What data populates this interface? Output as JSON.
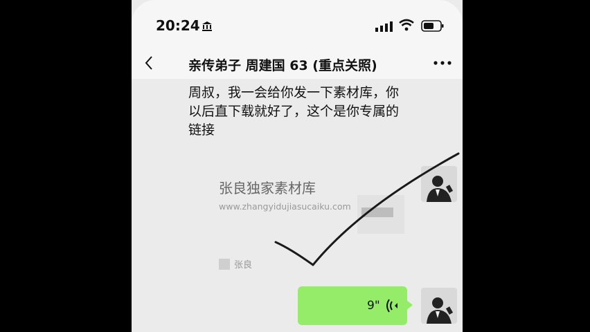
{
  "status_bar": {
    "time": "20:24",
    "icons": [
      "bank-icon",
      "signal-icon",
      "wifi-icon",
      "battery-icon"
    ]
  },
  "chat_header": {
    "back_icon": "chevron-left-icon",
    "title": "亲传弟子 周建国 63 (重点关照)",
    "more_icon": "more-dots-icon"
  },
  "messages": {
    "text_message": "周叔，我一会给你发一下素材库，你以后直下载就好了，这个是你专属的链接",
    "link_card": {
      "title": "张良独家素材库",
      "url": "www.zhangyidujiasucaiku.com",
      "author": "张良"
    },
    "voice_message": {
      "duration": "9\"",
      "icon": "voice-wave-icon"
    }
  },
  "colors": {
    "background": "#ebebeb",
    "voice_bubble": "#95ec69",
    "overlay_stroke": "#1a1a1a"
  }
}
